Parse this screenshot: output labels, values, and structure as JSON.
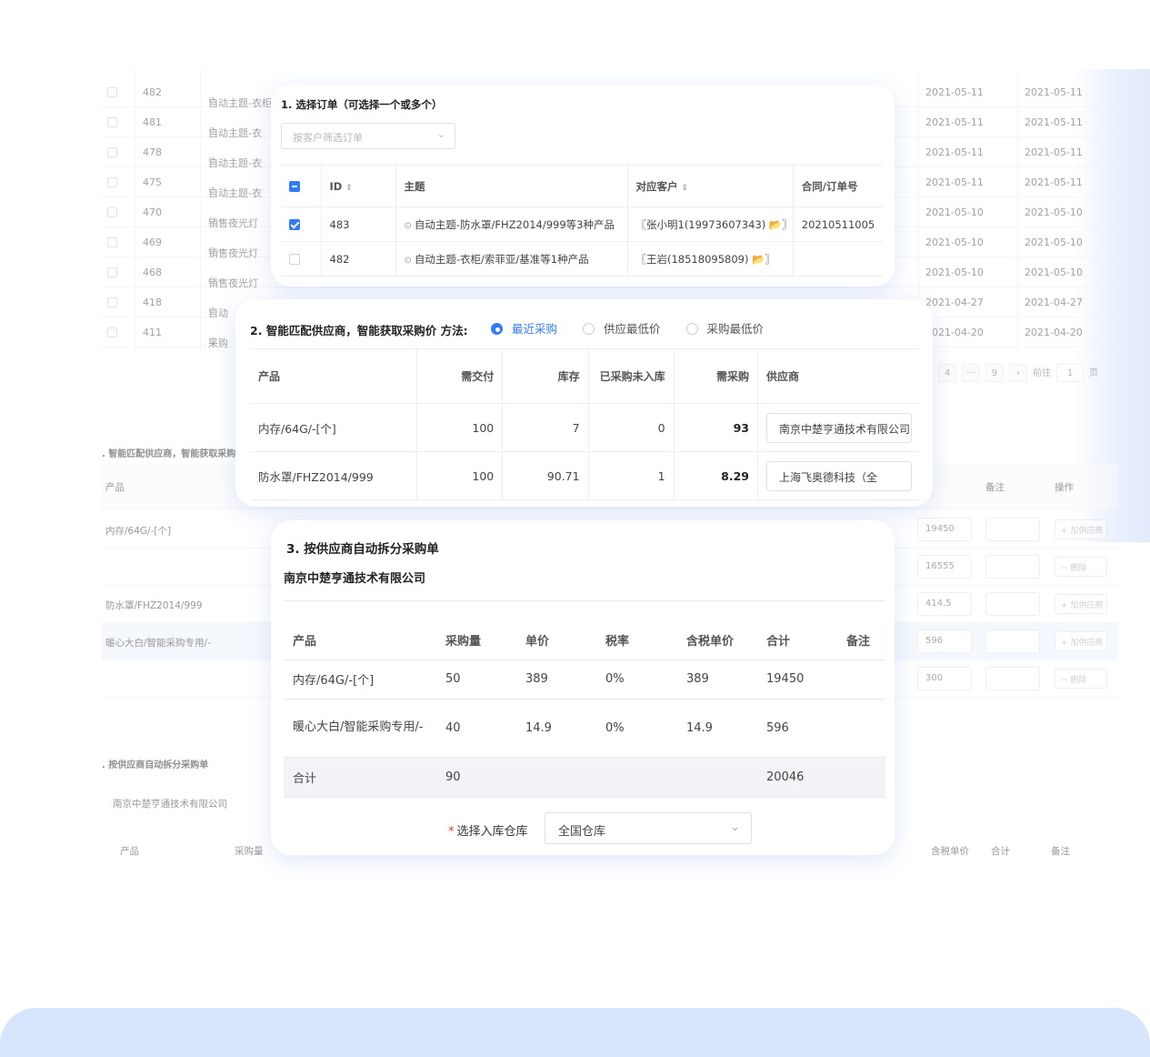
{
  "background_rows": [
    {
      "id": "482",
      "subject": "自动主题-衣柜",
      "date1": "2021-05-11",
      "date2": "2021-05-11"
    },
    {
      "id": "481",
      "subject": "自动主题-衣",
      "date1": "2021-05-11",
      "date2": "2021-05-11"
    },
    {
      "id": "478",
      "subject": "自动主题-衣",
      "date1": "2021-05-11",
      "date2": "2021-05-11"
    },
    {
      "id": "475",
      "subject": "自动主题-衣",
      "date1": "2021-05-11",
      "date2": "2021-05-11"
    },
    {
      "id": "470",
      "subject": "销售夜光灯",
      "date1": "2021-05-10",
      "date2": "2021-05-10"
    },
    {
      "id": "469",
      "subject": "销售夜光灯",
      "date1": "2021-05-10",
      "date2": "2021-05-10"
    },
    {
      "id": "468",
      "subject": "销售夜光灯",
      "date1": "2021-05-10",
      "date2": "2021-05-10"
    },
    {
      "id": "418",
      "subject": "自动",
      "date1": "2021-04-27",
      "date2": "2021-04-27"
    },
    {
      "id": "411",
      "subject": "采购",
      "date1": "2021-04-20",
      "date2": "2021-04-20"
    }
  ],
  "background_pager": {
    "p4": "4",
    "ellipsis": "···",
    "p9": "9",
    "next": "›",
    "goto": "前往",
    "page_value": "1",
    "page_suffix": "页"
  },
  "background_section2": {
    "title": ". 智能匹配供应商，智能获取采购",
    "col_product": "产品",
    "col_remark": "备注",
    "col_action": "操作",
    "rows": [
      {
        "product": "内存/64G/-[个]",
        "amount": "19450",
        "action": "+ 加供应商"
      },
      {
        "product": "",
        "amount": "16555",
        "action": "− 删除"
      },
      {
        "product": "防水罩/FHZ2014/999",
        "amount": "414.5",
        "action": "+ 加供应商"
      },
      {
        "product": "暖心大白/智能采购专用/-",
        "amount": "596",
        "action": "+ 加供应商"
      },
      {
        "product": "",
        "amount": "300",
        "action": "− 删除"
      }
    ]
  },
  "background_section3": {
    "title": ". 按供应商自动拆分采购单",
    "supplier": "南京中楚亨通技术有限公司",
    "col_product": "产品",
    "col_qty": "采购量",
    "col_taxprice": "含税单价",
    "col_total": "合计",
    "col_remark": "备注"
  },
  "card1": {
    "title": "1. 选择订单（可选择一个或多个）",
    "filter_placeholder": "按客户筛选订单",
    "headers": {
      "id": "ID",
      "subject": "主题",
      "customer": "对应客户",
      "contract": "合同/订单号"
    },
    "rows": [
      {
        "checked": true,
        "id": "483",
        "subject": "自动主题-防水罩/FHZ2014/999等3种产品",
        "customer": "〖张小明1(19973607343) 📂〗",
        "contract": "20210511005"
      },
      {
        "checked": false,
        "id": "482",
        "subject": "自动主题-衣柜/索菲亚/基准等1种产品",
        "customer": "〖王岩(18518095809) 📂〗",
        "contract": ""
      }
    ]
  },
  "card2": {
    "title": "2. 智能匹配供应商，智能获取采购价 方法:",
    "methods": [
      "最近采购",
      "供应最低价",
      "采购最低价"
    ],
    "selected_method": "最近采购",
    "headers": {
      "product": "产品",
      "deliver": "需交付",
      "stock": "库存",
      "pending": "已采购未入库",
      "need": "需采购",
      "supplier": "供应商"
    },
    "rows": [
      {
        "product": "内存/64G/-[个]",
        "deliver": "100",
        "stock": "7",
        "pending": "0",
        "need": "93",
        "supplier": "南京中楚亨通技术有限公司"
      },
      {
        "product": "防水罩/FHZ2014/999",
        "deliver": "100",
        "stock": "90.71",
        "pending": "1",
        "need": "8.29",
        "supplier": "上海飞奥德科技（全"
      }
    ]
  },
  "card3": {
    "title": "3. 按供应商自动拆分采购单",
    "supplier": "南京中楚亨通技术有限公司",
    "headers": {
      "product": "产品",
      "qty": "采购量",
      "price": "单价",
      "tax": "税率",
      "taxprice": "含税单价",
      "total": "合计",
      "remark": "备注"
    },
    "rows": [
      {
        "product": "内存/64G/-[个]",
        "qty": "50",
        "price": "389",
        "tax": "0%",
        "taxprice": "389",
        "total": "19450",
        "remark": ""
      },
      {
        "product": "暖心大白/智能采购专用/-",
        "qty": "40",
        "price": "14.9",
        "tax": "0%",
        "taxprice": "14.9",
        "total": "596",
        "remark": ""
      }
    ],
    "total_row": {
      "label": "合计",
      "qty": "90",
      "total": "20046"
    },
    "warehouse_label": "选择入库仓库",
    "warehouse_value": "全国仓库"
  },
  "colors": {
    "accent": "#2f7cf6",
    "required": "#e4393c",
    "bottom_band": "#d6e4fc"
  }
}
